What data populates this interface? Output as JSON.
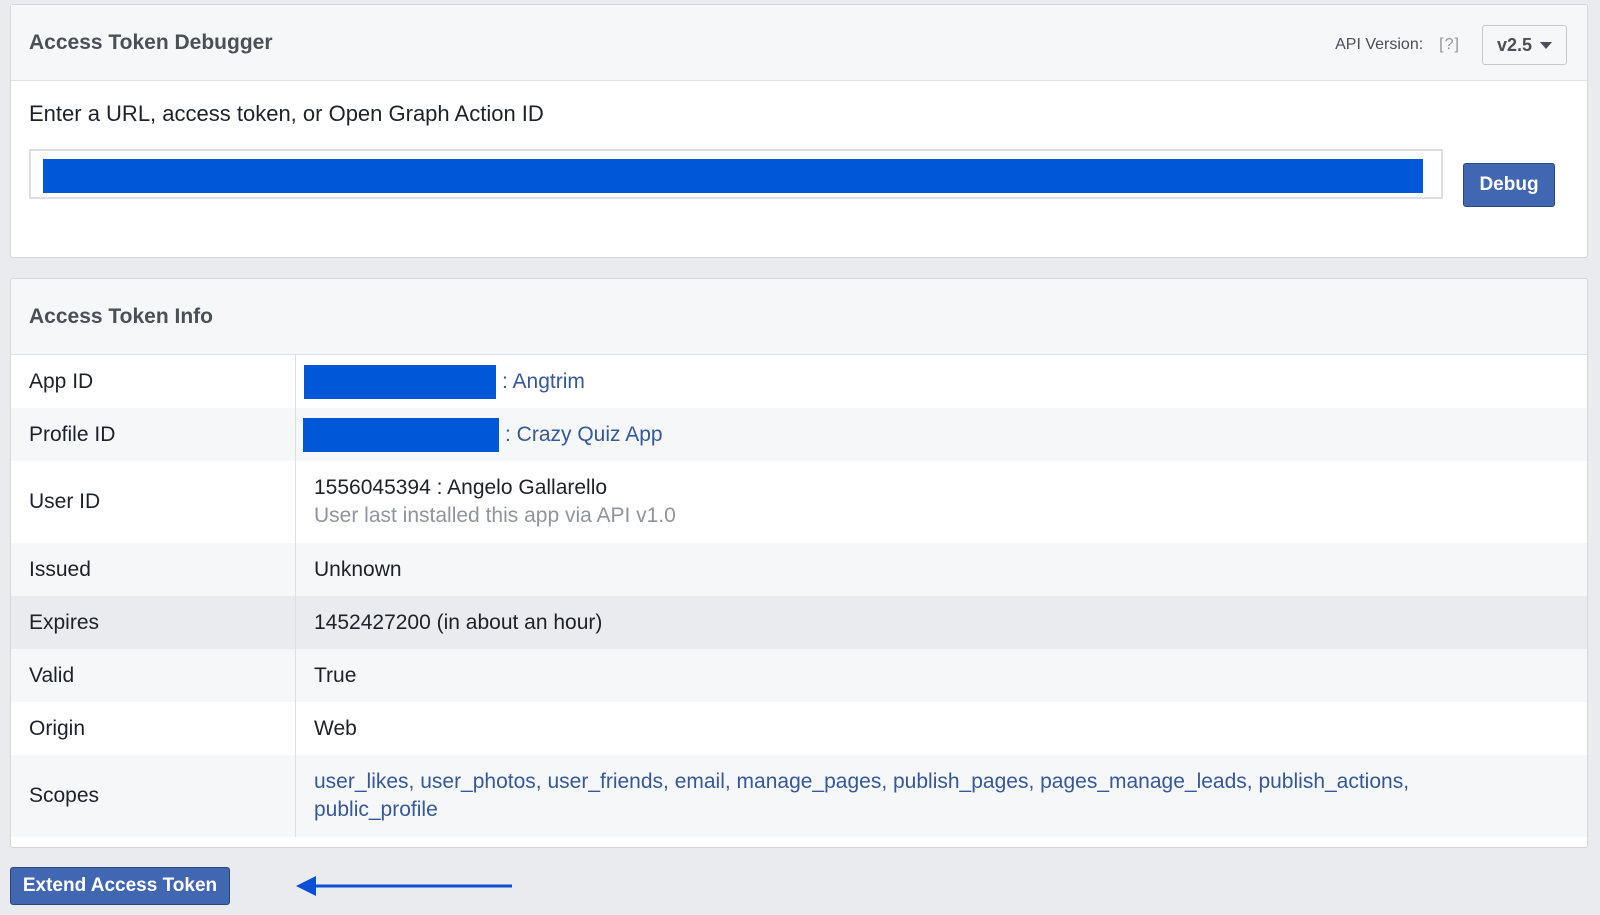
{
  "debugger": {
    "title": "Access Token Debugger",
    "api_version_label": "API Version:",
    "api_help": "[?]",
    "api_version_value": "v2.5",
    "prompt": "Enter a URL, access token, or Open Graph Action ID",
    "debug_button": "Debug"
  },
  "info": {
    "title": "Access Token Info",
    "rows": {
      "app_id": {
        "key": "App ID",
        "value": ": Angtrim"
      },
      "profile_id": {
        "key": "Profile ID",
        "value": ": Crazy Quiz App"
      },
      "user_id": {
        "key": "User ID",
        "value": "1556045394 : Angelo Gallarello",
        "sub": "User last installed this app via API v1.0"
      },
      "issued": {
        "key": "Issued",
        "value": "Unknown"
      },
      "expires": {
        "key": "Expires",
        "value": "1452427200 (in about an hour)"
      },
      "valid": {
        "key": "Valid",
        "value": "True"
      },
      "origin": {
        "key": "Origin",
        "value": "Web"
      },
      "scopes": {
        "key": "Scopes",
        "value": "user_likes, user_photos, user_friends, email, manage_pages, publish_pages, pages_manage_leads, publish_actions, public_profile"
      }
    }
  },
  "actions": {
    "extend_button": "Extend Access Token"
  },
  "colors": {
    "redaction": "#0057d8",
    "button": "#4267b2",
    "link": "#365899",
    "arrow": "#0a4fd6"
  }
}
